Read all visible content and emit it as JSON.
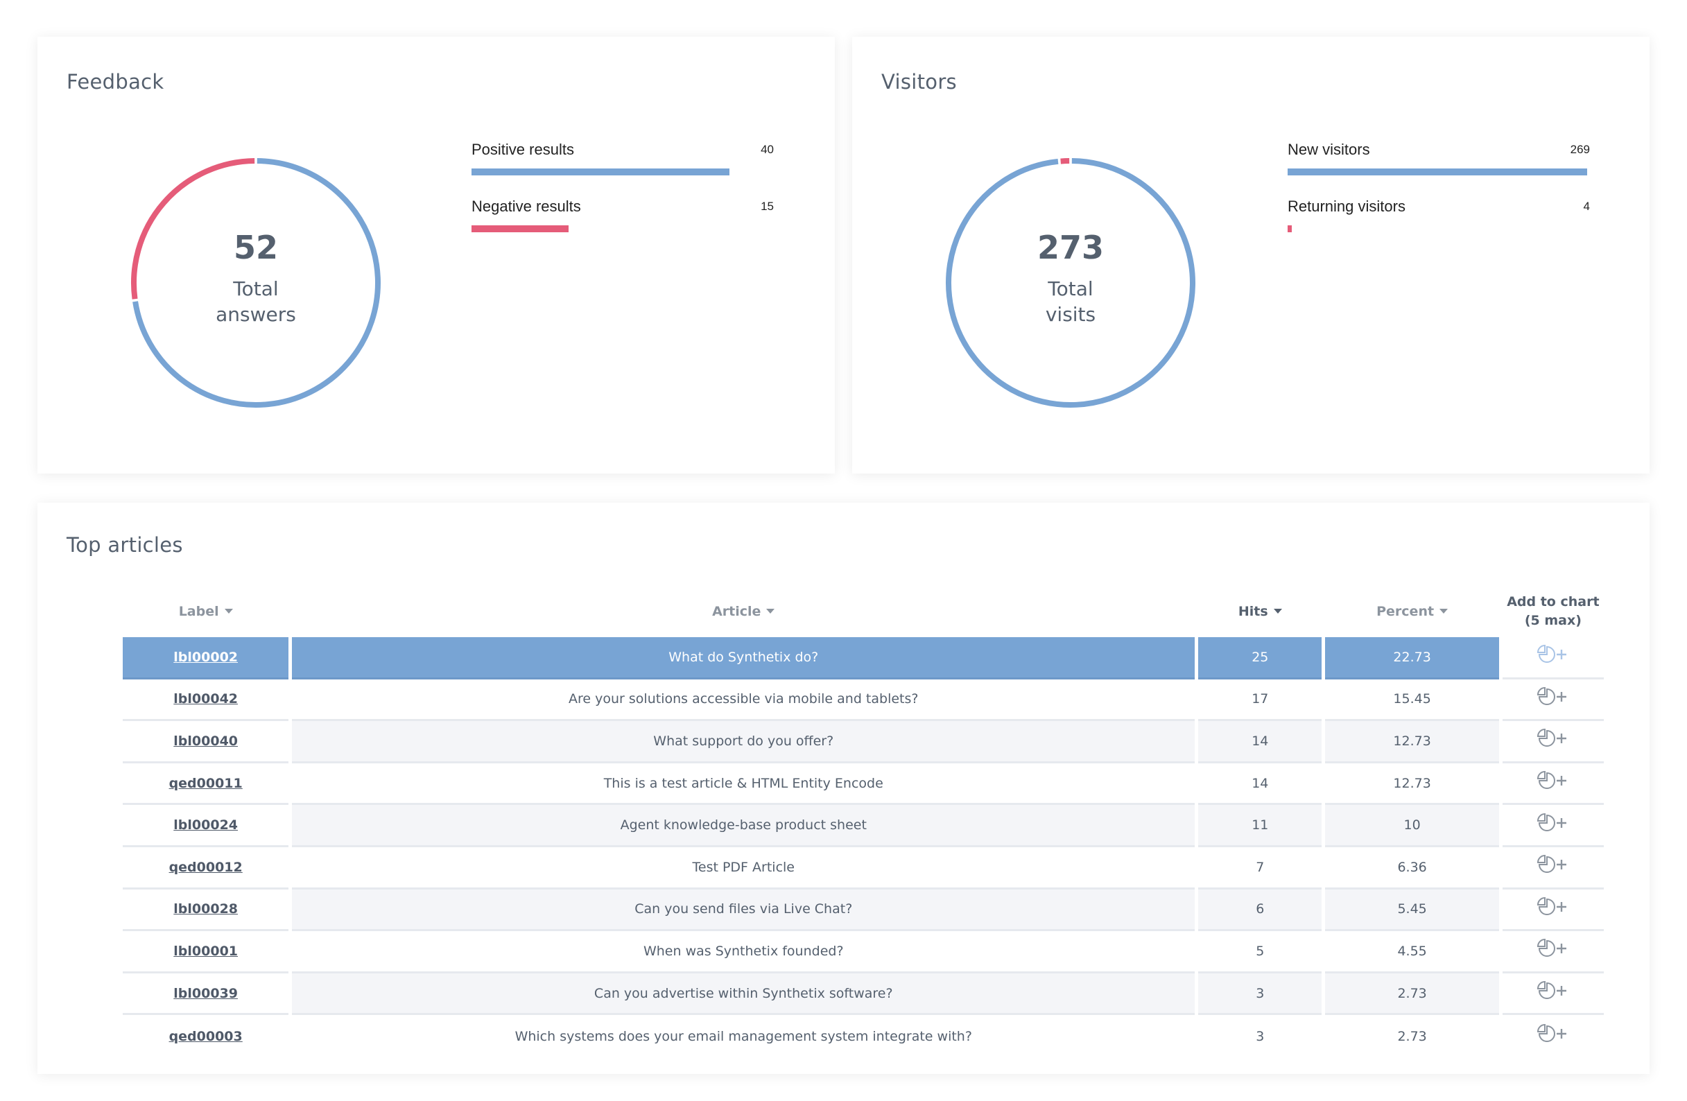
{
  "feedback": {
    "title": "Feedback",
    "total": "52",
    "total_caption": "Total answers",
    "items": [
      {
        "label": "Positive results",
        "value": 40,
        "value_text": "40",
        "color": "#78a4d4"
      },
      {
        "label": "Negative results",
        "value": 15,
        "value_text": "15",
        "color": "#e55c79"
      }
    ]
  },
  "visitors": {
    "title": "Visitors",
    "total": "273",
    "total_caption": "Total visits",
    "items": [
      {
        "label": "New visitors",
        "value": 269,
        "value_text": "269",
        "color": "#78a4d4"
      },
      {
        "label": "Returning visitors",
        "value": 4,
        "value_text": "4",
        "color": "#e55c79"
      }
    ]
  },
  "articles": {
    "title": "Top articles",
    "columns": {
      "label": "Label",
      "article": "Article",
      "hits": "Hits",
      "percent": "Percent",
      "add_line1": "Add to chart",
      "add_line2": "(5 max)"
    },
    "add_icon": "pie-chart-plus-icon",
    "rows": [
      {
        "label": "lbl00002",
        "article": "What do Synthetix do?",
        "hits": "25",
        "percent": "22.73",
        "selected": true
      },
      {
        "label": "lbl00042",
        "article": "Are your solutions accessible via mobile and tablets?",
        "hits": "17",
        "percent": "15.45"
      },
      {
        "label": "lbl00040",
        "article": "What support do you offer?",
        "hits": "14",
        "percent": "12.73"
      },
      {
        "label": "qed00011",
        "article": "This is a test article & HTML Entity Encode",
        "hits": "14",
        "percent": "12.73"
      },
      {
        "label": "lbl00024",
        "article": "Agent knowledge-base product sheet",
        "hits": "11",
        "percent": "10"
      },
      {
        "label": "qed00012",
        "article": "Test PDF Article",
        "hits": "7",
        "percent": "6.36"
      },
      {
        "label": "lbl00028",
        "article": "Can you send files via Live Chat?",
        "hits": "6",
        "percent": "5.45"
      },
      {
        "label": "lbl00001",
        "article": "When was Synthetix founded?",
        "hits": "5",
        "percent": "4.55"
      },
      {
        "label": "lbl00039",
        "article": "Can you advertise within Synthetix software?",
        "hits": "3",
        "percent": "2.73"
      },
      {
        "label": "qed00003",
        "article": "Which systems does your email management system integrate with?",
        "hits": "3",
        "percent": "2.73"
      }
    ]
  },
  "colors": {
    "accent_blue": "#78a4d4",
    "accent_red": "#e55c79",
    "icon_gray": "#8c949e",
    "icon_selected": "#a9c4e6"
  }
}
